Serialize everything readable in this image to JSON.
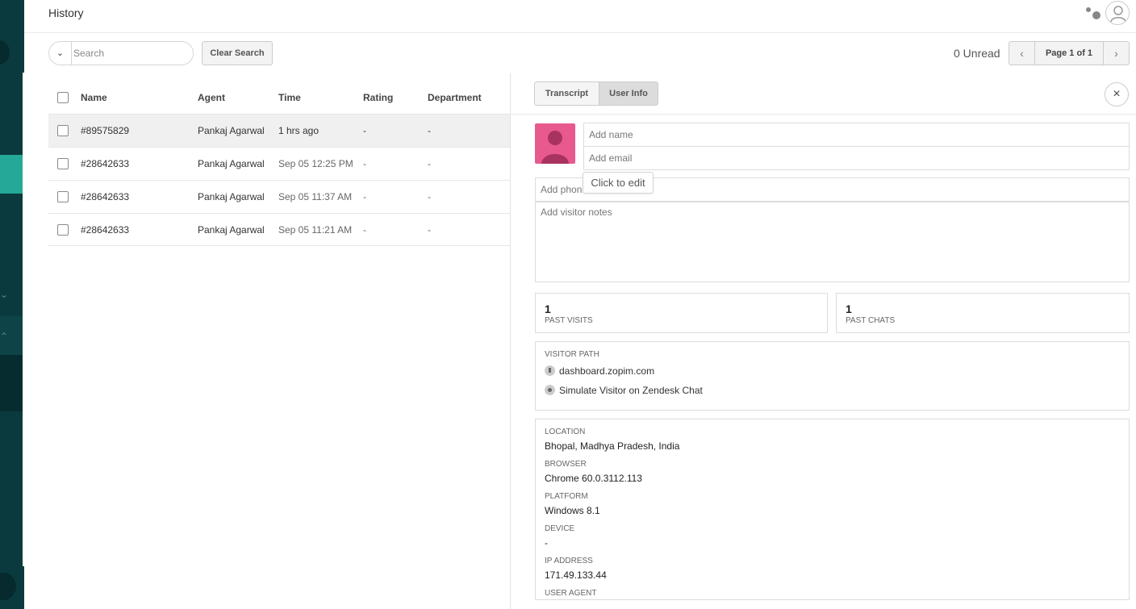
{
  "header": {
    "title": "History"
  },
  "toolbar": {
    "search_placeholder": "Search",
    "clear_label": "Clear Search",
    "unread": "0 Unread",
    "page_label": "Page 1 of 1"
  },
  "table": {
    "columns": [
      "Name",
      "Agent",
      "Time",
      "Rating",
      "Department"
    ],
    "rows": [
      {
        "name": "#89575829",
        "agent": "Pankaj Agarwal",
        "time": "1 hrs ago",
        "rating": "-",
        "department": "-"
      },
      {
        "name": "#28642633",
        "agent": "Pankaj Agarwal",
        "time": "Sep 05 12:25 PM",
        "rating": "-",
        "department": "-"
      },
      {
        "name": "#28642633",
        "agent": "Pankaj Agarwal",
        "time": "Sep 05 11:37 AM",
        "rating": "-",
        "department": "-"
      },
      {
        "name": "#28642633",
        "agent": "Pankaj Agarwal",
        "time": "Sep 05 11:21 AM",
        "rating": "-",
        "department": "-"
      }
    ]
  },
  "panel": {
    "tabs": [
      "Transcript",
      "User Info"
    ],
    "active_tab": "User Info",
    "name_placeholder": "Add name",
    "email_placeholder": "Add email",
    "phone_placeholder": "Add phon",
    "notes_placeholder": "Add visitor notes",
    "tooltip": "Click to edit",
    "past_visits": {
      "value": "1",
      "label": "PAST VISITS"
    },
    "past_chats": {
      "value": "1",
      "label": "PAST CHATS"
    },
    "visitor_path": {
      "heading": "VISITOR PATH",
      "items": [
        "dashboard.zopim.com",
        "Simulate Visitor on Zendesk Chat"
      ]
    },
    "info": {
      "location_label": "LOCATION",
      "location": "Bhopal, Madhya Pradesh, India",
      "browser_label": "BROWSER",
      "browser": "Chrome 60.0.3112.113",
      "platform_label": "PLATFORM",
      "platform": "Windows 8.1",
      "device_label": "DEVICE",
      "device": "-",
      "ip_label": "IP ADDRESS",
      "ip": "171.49.133.44",
      "ua_label": "USER AGENT"
    }
  },
  "colors": {
    "sidebar": "#0a3a3e",
    "accent": "#25a897",
    "avatar": "#e8598e"
  },
  "icons": [
    "chevron-down-icon",
    "chevron-left-icon",
    "chevron-right-icon",
    "close-icon",
    "user-avatar-icon",
    "status-dots-icon",
    "download-icon",
    "dot-icon"
  ]
}
